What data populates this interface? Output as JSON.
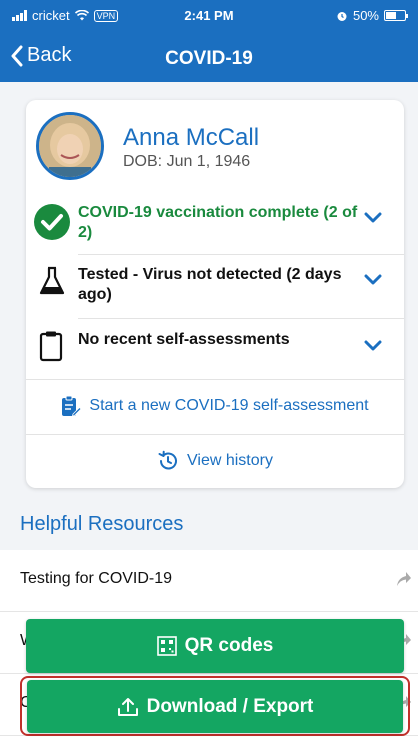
{
  "status_bar": {
    "carrier": "cricket",
    "vpn": "VPN",
    "time": "2:41 PM",
    "battery": "50%"
  },
  "nav": {
    "back_label": "Back",
    "title": "COVID-19"
  },
  "patient": {
    "name": "Anna McCall",
    "dob": "DOB: Jun 1, 1946"
  },
  "status_rows": [
    {
      "text": "COVID-19 vaccination complete (2 of 2)",
      "color": "#1a8a3e",
      "icon": "check-circle-icon"
    },
    {
      "text": "Tested - Virus not detected (2 days ago)",
      "color": "#111111",
      "icon": "flask-icon"
    },
    {
      "text": "No recent self-assessments",
      "color": "#111111",
      "icon": "clipboard-icon"
    }
  ],
  "links": {
    "self_assessment": "Start a new COVID-19 self-assessment",
    "history": "View history"
  },
  "resources": {
    "title": "Helpful Resources",
    "items": [
      {
        "label": "Testing for COVID-19"
      },
      {
        "label": "W"
      },
      {
        "label": "C"
      }
    ]
  },
  "buttons": {
    "qr": "QR codes",
    "download": "Download / Export"
  },
  "colors": {
    "primary": "#1b6fc0",
    "success": "#14a662",
    "highlight": "#c0302b"
  }
}
